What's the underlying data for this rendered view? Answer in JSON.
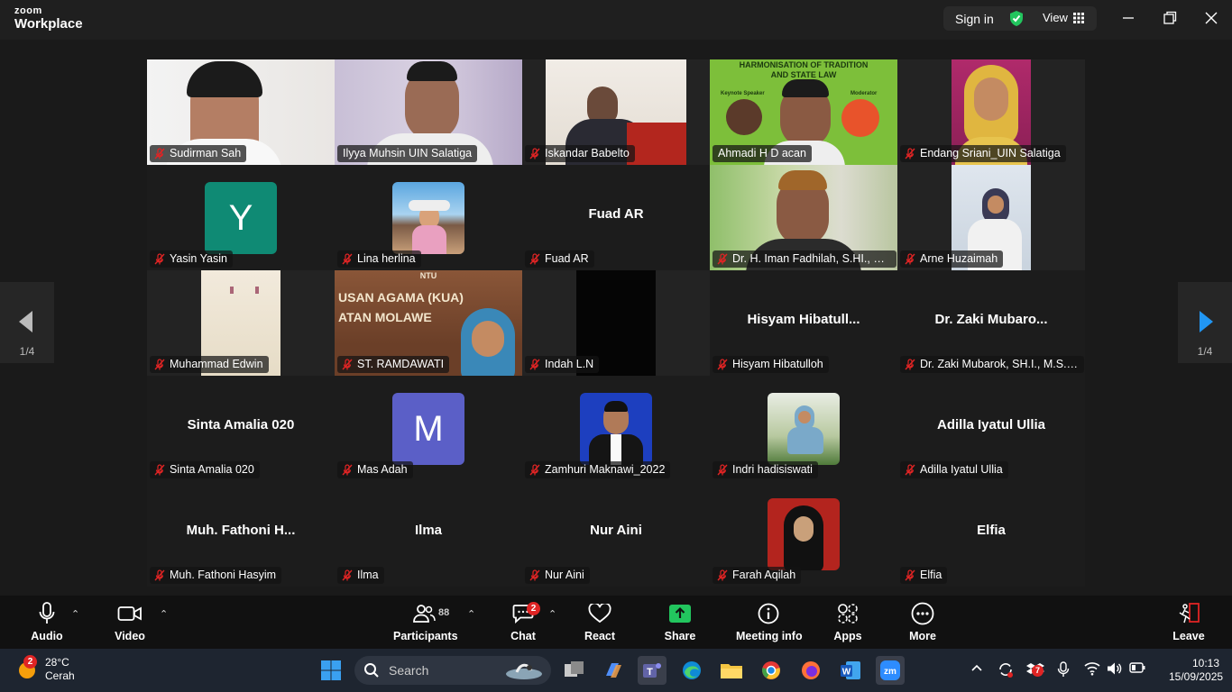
{
  "app": {
    "brand_top": "zoom",
    "brand_bottom": "Workplace"
  },
  "titlebar": {
    "sign_in": "Sign in",
    "view": "View"
  },
  "pagination": {
    "left": "1/4",
    "right": "1/4"
  },
  "participants": [
    {
      "name": "Sudirman Sah",
      "type": "video"
    },
    {
      "name": "Ilyya Muhsin UIN Salatiga",
      "type": "video"
    },
    {
      "name": "Iskandar Babelto",
      "type": "video"
    },
    {
      "name": "Ahmadi H D acan",
      "type": "video",
      "banner_line1": "HARMONISATION OF TRADITION",
      "banner_line2": "AND STATE LAW",
      "banner_left": "Keynote Speaker",
      "banner_right": "Moderator"
    },
    {
      "name": "Endang Sriani_UIN Salatiga",
      "type": "video"
    },
    {
      "name": "Yasin Yasin",
      "type": "avatar",
      "initial": "Y",
      "color": "#0f8a74"
    },
    {
      "name": "Lina herlina",
      "type": "photo"
    },
    {
      "name": "Fuad AR",
      "type": "text",
      "display": "Fuad AR"
    },
    {
      "name": "Dr. H. Iman Fadhilah, S.HI., M.SI",
      "type": "video"
    },
    {
      "name": "Arne Huzaimah",
      "type": "video"
    },
    {
      "name": "Muhammad Edwin",
      "type": "video"
    },
    {
      "name": "ST. RAMDAWATI",
      "type": "video",
      "sign_line1": "USAN AGAMA (KUA)",
      "sign_line2": "ATAN MOLAWE",
      "sign_top": "NTU"
    },
    {
      "name": "Indah L.N",
      "type": "video"
    },
    {
      "name": "Hisyam Hibatulloh",
      "type": "text",
      "display": "Hisyam  Hibatull..."
    },
    {
      "name": "Dr. Zaki Mubarok, SH.I., M.S.I ...",
      "type": "text",
      "display": "Dr. Zaki  Mubaro..."
    },
    {
      "name": "Sinta Amalia 020",
      "type": "text",
      "display": "Sinta Amalia 020"
    },
    {
      "name": "Mas Adah",
      "type": "avatar",
      "initial": "M",
      "color": "#5b5fc7"
    },
    {
      "name": "Zamhuri Maknawi_2022",
      "type": "photo"
    },
    {
      "name": "Indri hadisiswati",
      "type": "photo"
    },
    {
      "name": "Adilla Iyatul Ullia",
      "type": "text",
      "display": "Adilla Iyatul Ullia"
    },
    {
      "name": "Muh. Fathoni Hasyim",
      "type": "text",
      "display": "Muh.  Fathoni  H..."
    },
    {
      "name": "Ilma",
      "type": "text",
      "display": "Ilma"
    },
    {
      "name": "Nur Aini",
      "type": "text",
      "display": "Nur Aini"
    },
    {
      "name": "Farah Aqilah",
      "type": "photo"
    },
    {
      "name": "Elfia",
      "type": "text",
      "display": "Elfia"
    }
  ],
  "toolbar": {
    "audio": "Audio",
    "video": "Video",
    "participants": "Participants",
    "participants_count": "88",
    "chat": "Chat",
    "chat_badge": "2",
    "react": "React",
    "share": "Share",
    "meeting_info": "Meeting info",
    "apps": "Apps",
    "more": "More",
    "leave": "Leave"
  },
  "taskbar": {
    "weather_temp": "28°C",
    "weather_desc": "Cerah",
    "weather_badge": "2",
    "search_placeholder": "Search",
    "time": "10:13",
    "date": "15/09/2025",
    "tray_badge": "7"
  },
  "colors": {
    "share_green": "#22c55e",
    "active_border": "#22c55e",
    "mute_red": "#e02424",
    "chevron_blue": "#2196f3"
  }
}
